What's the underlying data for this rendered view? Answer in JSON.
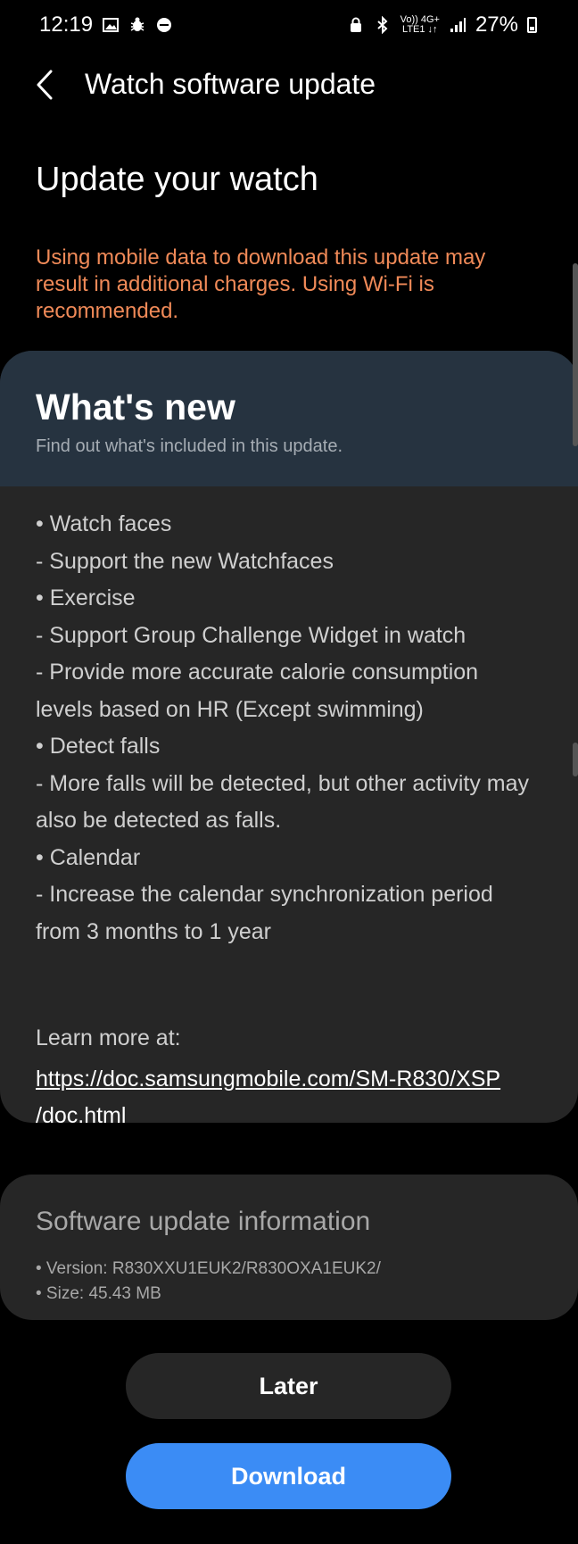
{
  "status_bar": {
    "time": "12:19",
    "left_icons": [
      "gallery-icon",
      "bug-icon",
      "news-icon"
    ],
    "net_top": "Vo)) 4G+",
    "net_bottom": "LTE1 ↓↑",
    "battery": "27%"
  },
  "header": {
    "title": "Watch software update"
  },
  "page": {
    "title": "Update your watch",
    "warning": "Using mobile data to download this update may result in additional charges. Using Wi-Fi is recommended."
  },
  "whats_new": {
    "title": "What's new",
    "subtitle": "Find out what's included in this update.",
    "lines": [
      "• Watch faces",
      " - Support the new Watchfaces",
      "• Exercise",
      " - Support Group Challenge Widget in watch",
      " - Provide more accurate calorie consumption",
      "levels based on HR (Except swimming)",
      "• Detect falls",
      " - More falls will be detected, but other activity may",
      "also be detected as falls.",
      "• Calendar",
      " - Increase the calendar synchronization period",
      "from 3 months to 1 year"
    ],
    "learn_more": "Learn more at:",
    "link_line1": "https://doc.samsungmobile.com/SM-R830/XSP",
    "link_line2": "/doc.html"
  },
  "software_info": {
    "title": "Software update information",
    "version": "• Version: R830XXU1EUK2/R830OXA1EUK2/",
    "size": "• Size: 45.43 MB"
  },
  "buttons": {
    "later": "Later",
    "download": "Download"
  },
  "colors": {
    "warning": "#f08a58",
    "accent": "#3b8cf5",
    "card": "#262626",
    "card_header": "#263340"
  }
}
